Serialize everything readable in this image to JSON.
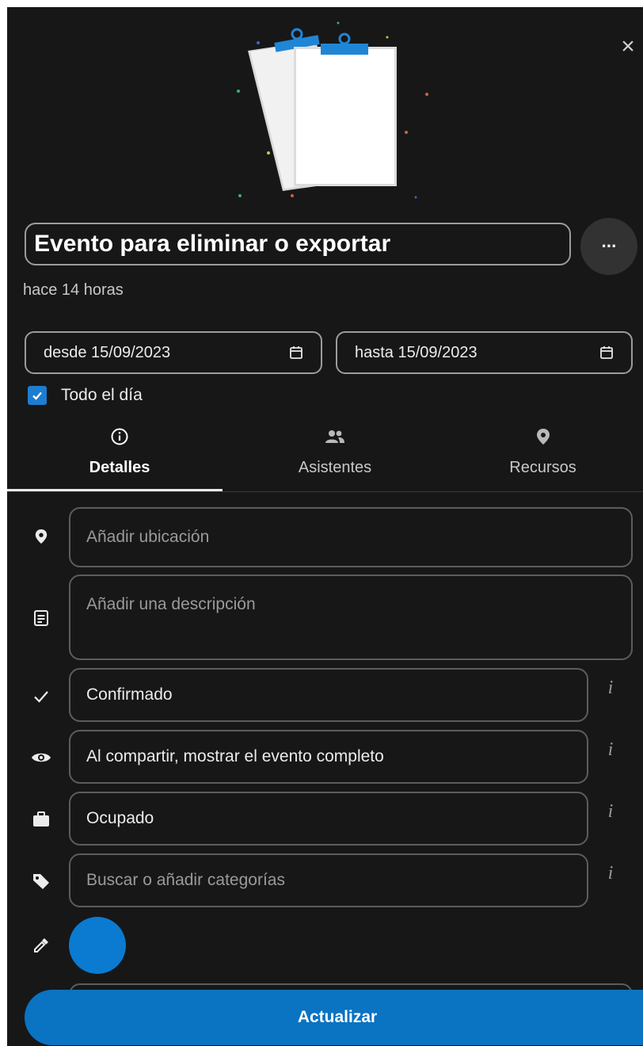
{
  "dialog": {
    "close_label": "×",
    "title": "Evento para eliminar o exportar",
    "more_label": "···",
    "created": "hace 14 horas"
  },
  "dates": {
    "start": "desde 15/09/2023",
    "end": "hasta 15/09/2023"
  },
  "allday": {
    "label": "Todo el día",
    "checked": true
  },
  "tabs": [
    {
      "label": "Detalles",
      "icon": "info-icon",
      "active": true
    },
    {
      "label": "Asistentes",
      "icon": "people-icon",
      "active": false
    },
    {
      "label": "Recursos",
      "icon": "location-pin-icon",
      "active": false
    }
  ],
  "details": {
    "location_placeholder": "Añadir ubicación",
    "description_placeholder": "Añadir una descripción",
    "status": "Confirmado",
    "sharing": "Al compartir, mostrar el evento completo",
    "availability": "Ocupado",
    "categories_placeholder": "Buscar o añadir categorías",
    "info_label": "i"
  },
  "colors": {
    "event_color": "#0a7bd1",
    "accent": "#0a73c2",
    "background": "#171717"
  },
  "footer": {
    "update_label": "Actualizar"
  }
}
